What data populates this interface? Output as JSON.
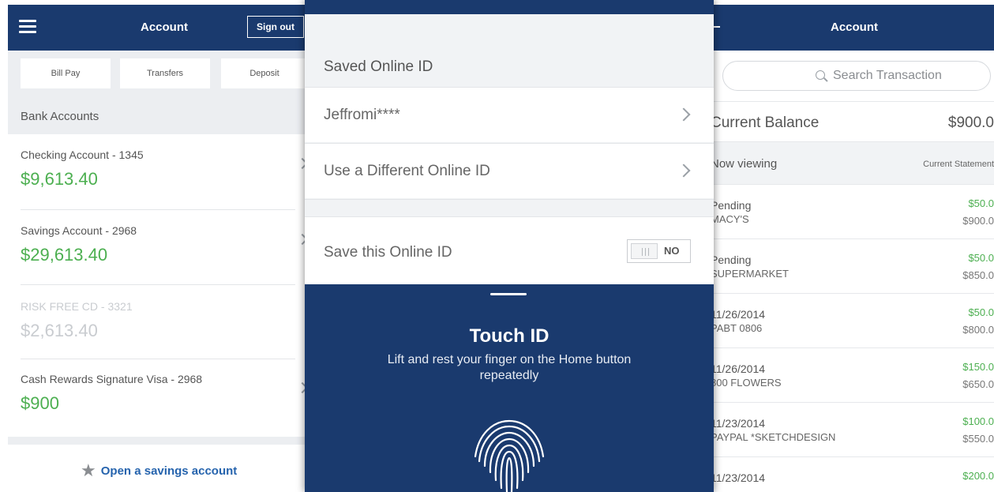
{
  "left_panel": {
    "title": "Account",
    "sign_out": "Sign out",
    "quick_actions": [
      "Bill Pay",
      "Transfers",
      "Deposit"
    ],
    "section_title": "Bank Accounts",
    "accounts": [
      {
        "name": "Checking Account - 1345",
        "balance": "$9,613.40",
        "disabled": false
      },
      {
        "name": "Savings Account - 2968",
        "balance": "$29,613.40",
        "disabled": false
      },
      {
        "name": "RISK FREE CD - 3321",
        "balance": "$2,613.40",
        "disabled": true
      },
      {
        "name": "Cash Rewards Signature Visa - 2968",
        "balance": "$900",
        "disabled": false
      }
    ],
    "open_savings": "Open a savings account",
    "open_savings_icon": "star-icon"
  },
  "middle_panel": {
    "saved_header": "Saved Online ID",
    "saved_id": "Jeffromi****",
    "different_id": "Use a Different Online ID",
    "save_label": "Save this Online ID",
    "save_toggle_state": "NO",
    "touch_title": "Touch ID",
    "touch_desc": "Lift and rest your finger on the Home button repeatedly",
    "touch_icon": "fingerprint-icon"
  },
  "right_panel": {
    "title": "Account",
    "search_placeholder": "Search Transaction",
    "current_balance_label": "Current Balance",
    "current_balance_value": "$900.0",
    "now_viewing_label": "Now viewing",
    "statement_label": "Current Statement",
    "transactions": [
      {
        "date": "Pending",
        "merchant": "MACY'S",
        "amount": "$50.0",
        "balance": "$900.0"
      },
      {
        "date": "Pending",
        "merchant": "SUPERMARKET",
        "amount": "$50.0",
        "balance": "$850.0"
      },
      {
        "date": "11/26/2014",
        "merchant": "PABT 0806",
        "amount": "$50.0",
        "balance": "$800.0"
      },
      {
        "date": "11/26/2014",
        "merchant": "800 FLOWERS",
        "amount": "$150.0",
        "balance": "$650.0"
      },
      {
        "date": "11/23/2014",
        "merchant": "PAYPAL *SKETCHDESIGN",
        "amount": "$100.0",
        "balance": "$550.0"
      },
      {
        "date": "11/23/2014",
        "merchant": "",
        "amount": "$200.0",
        "balance": ""
      }
    ]
  },
  "colors": {
    "navy": "#1a3a6e",
    "green": "#4caf50",
    "link_blue": "#2563ad"
  }
}
